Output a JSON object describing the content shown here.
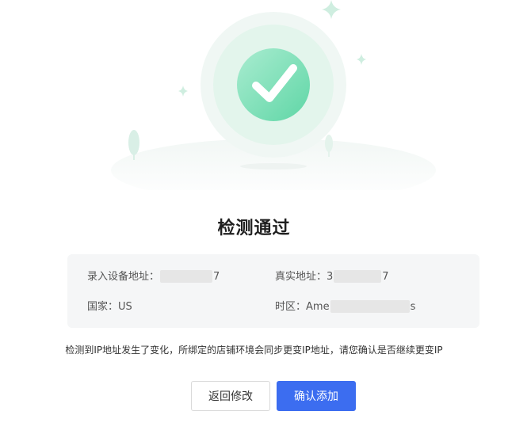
{
  "status": {
    "title": "检测通过"
  },
  "info": {
    "entered_ip_label": "录入设备地址：",
    "entered_ip_visible_prefix": "",
    "entered_ip_visible_suffix": "7",
    "real_ip_label": "真实地址：",
    "real_ip_visible_prefix": "3",
    "real_ip_visible_suffix": "7",
    "country_label": "国家：",
    "country_value": "US",
    "timezone_label": "时区：",
    "timezone_visible_prefix": "Ame",
    "timezone_visible_suffix": "s"
  },
  "notice": "检测到IP地址发生了变化，所绑定的店铺环境会同步更变IP地址，请您确认是否继续更变IP",
  "buttons": {
    "back_label": "返回修改",
    "confirm_label": "确认添加"
  },
  "colors": {
    "primary": "#3c6df0",
    "success_green": "#5fd6a6"
  },
  "icons": {
    "status": "check-circle-icon",
    "sparkles": "sparkle-icon",
    "trees": "tree-icon"
  }
}
